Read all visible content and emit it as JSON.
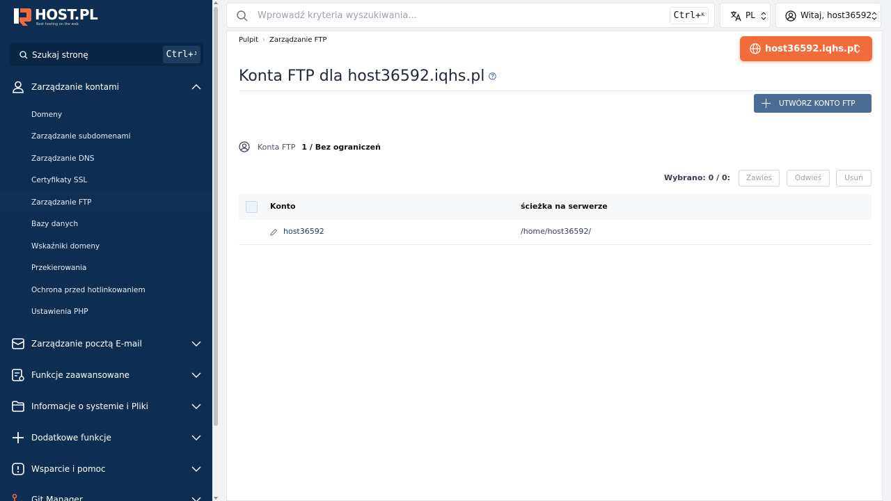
{
  "brand": {
    "name": "HOST.PL",
    "tagline": "Best hosting on the web"
  },
  "sidebar": {
    "search_label": "Szukaj stronę",
    "search_shortcut": "Ctrl+",
    "search_shortcut_key": "J",
    "groups": [
      {
        "label": "Zarządzanie kontami",
        "icon": "user-icon",
        "expanded": true
      },
      {
        "label": "Zarządzanie pocztą E-mail",
        "icon": "mail-icon",
        "expanded": false
      },
      {
        "label": "Funkcje zaawansowane",
        "icon": "advanced-settings-icon",
        "expanded": false
      },
      {
        "label": "Informacje o systemie i Pliki",
        "icon": "folder-icon",
        "expanded": false
      },
      {
        "label": "Dodatkowe funkcje",
        "icon": "plus-icon",
        "expanded": false
      },
      {
        "label": "Wsparcie i pomoc",
        "icon": "alert-icon",
        "expanded": false
      },
      {
        "label": "Git Manager",
        "icon": "git-icon",
        "expanded": false
      }
    ],
    "sub_items": [
      "Domeny",
      "Zarządzanie subdomenami",
      "Zarządzanie DNS",
      "Certyfikaty SSL",
      "Zarządzanie FTP",
      "Bazy danych",
      "Wskaźniki domeny",
      "Przekierowania",
      "Ochrona przed hotlinkowaniem",
      "Ustawienia PHP"
    ],
    "active_sub_item": "Zarządzanie FTP"
  },
  "topbar": {
    "search_placeholder": "Wprowadź kryteria wyszukiwania...",
    "search_shortcut": "Ctrl+",
    "search_shortcut_key": "K",
    "language": "PL",
    "user_greeting": "Witaj, host36592"
  },
  "breadcrumb": [
    "Pulpit",
    "Zarządzanie FTP"
  ],
  "domain_selector": "host36592.iqhs.pl",
  "page_title": "Konta FTP dla host36592.iqhs.pl",
  "create_button": "UTWÓRZ KONTO FTP",
  "quota": {
    "label": "Konta FTP",
    "value": "1 / Bez ograniczeń"
  },
  "selection": {
    "label": "Wybrano: 0 / 0:",
    "actions": [
      "Zawieś",
      "Odwieś",
      "Usuń"
    ]
  },
  "table": {
    "columns": [
      "Konto",
      "ścieżka na serwerze"
    ],
    "rows": [
      {
        "account": "host36592",
        "path": "/home/host36592/"
      }
    ]
  },
  "colors": {
    "sidebar": "#0d2d52",
    "accent": "#f26b3a",
    "primary_button": "#4a6d96"
  }
}
